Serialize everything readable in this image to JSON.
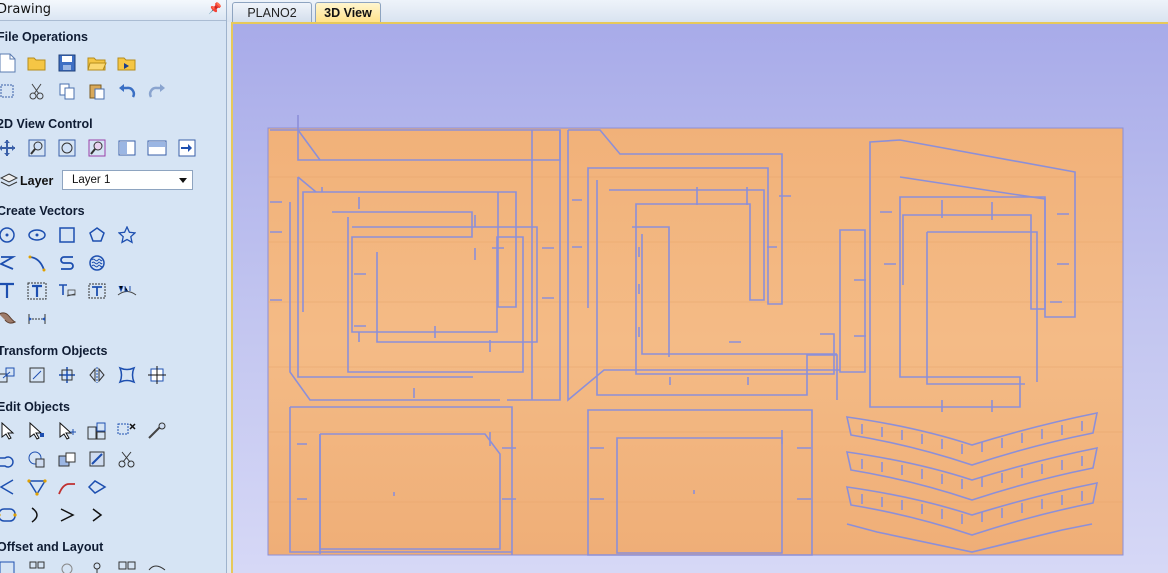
{
  "panel": {
    "title": "Drawing",
    "pin_icon": "pin-icon",
    "sections": {
      "file_operations": "File Operations",
      "view_control": "2D View Control",
      "create_vectors": "Create Vectors",
      "transform_objects": "Transform Objects",
      "edit_objects": "Edit Objects",
      "offset_layout": "Offset and Layout"
    },
    "layer": {
      "label": "Layer",
      "value": "Layer 1"
    }
  },
  "tabs": [
    {
      "label": "PLANO2",
      "active": false
    },
    {
      "label": "3D View",
      "active": true
    }
  ],
  "colors": {
    "panel_bg": "#d6e4f4",
    "viewport_bg": "#b4b7ee",
    "material": "#f2b57d",
    "cut_line": "#8c8fd8",
    "active_tab": "#ffe38c"
  }
}
